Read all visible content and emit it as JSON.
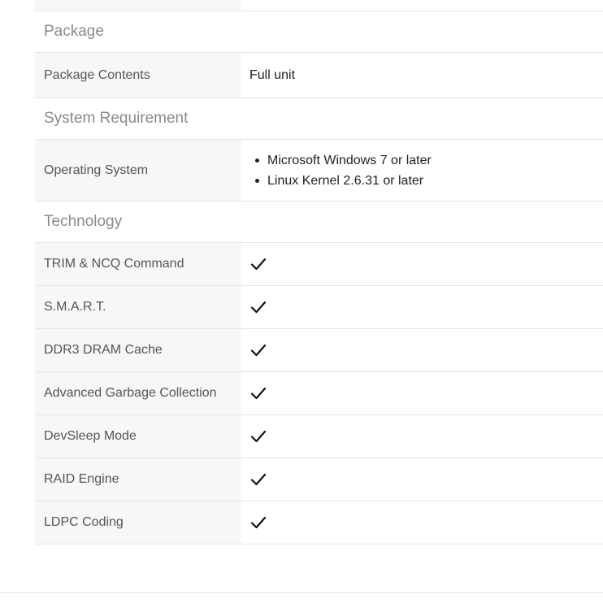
{
  "sections": {
    "package": {
      "title": "Package",
      "rows": [
        {
          "label": "Package Contents",
          "value": "Full unit"
        }
      ]
    },
    "system": {
      "title": "System Requirement",
      "rows": [
        {
          "label": "Operating System",
          "values": [
            "Microsoft Windows 7 or later",
            "Linux Kernel 2.6.31 or later"
          ]
        }
      ]
    },
    "technology": {
      "title": "Technology",
      "rows": [
        {
          "label": "TRIM & NCQ Command",
          "supported": true,
          "icon": "checkmark-icon"
        },
        {
          "label": "S.M.A.R.T.",
          "supported": true,
          "icon": "checkmark-icon"
        },
        {
          "label": "DDR3 DRAM Cache",
          "supported": true,
          "icon": "checkmark-icon"
        },
        {
          "label": "Advanced Garbage Collection",
          "supported": true,
          "icon": "checkmark-icon"
        },
        {
          "label": "DevSleep Mode",
          "supported": true,
          "icon": "checkmark-icon"
        },
        {
          "label": "RAID Engine",
          "supported": true,
          "icon": "checkmark-icon"
        },
        {
          "label": "LDPC Coding",
          "supported": true,
          "icon": "checkmark-icon"
        }
      ]
    }
  },
  "colors": {
    "label_background": "#f7f7f8",
    "section_title": "#8a8a8a",
    "border": "#e5e5e5"
  }
}
